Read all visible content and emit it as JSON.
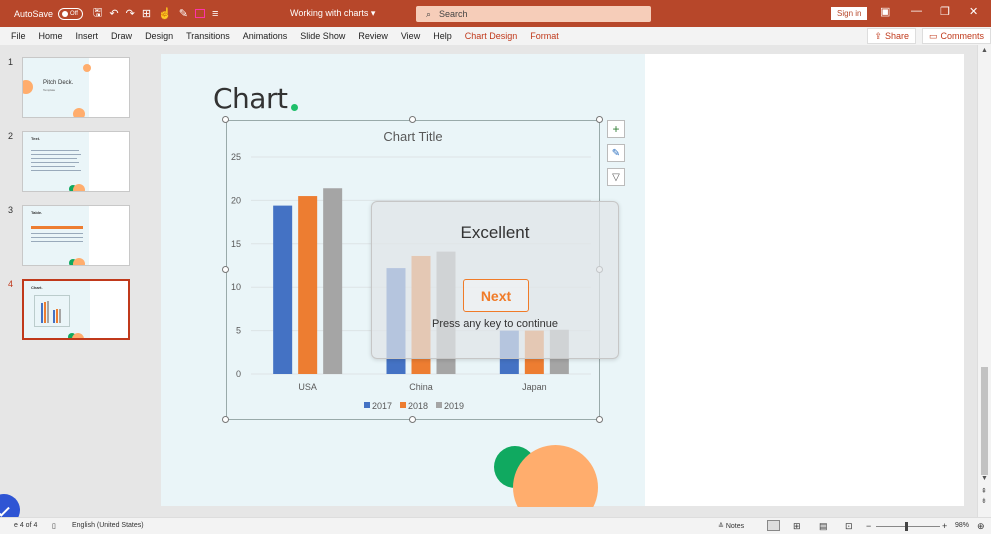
{
  "titlebar": {
    "autosave_label": "AutoSave",
    "autosave_state": "Off",
    "doc_title": "Working with charts",
    "search_placeholder": "Search",
    "sign_in": "Sign in"
  },
  "menu": {
    "tabs": [
      "File",
      "Home",
      "Insert",
      "Draw",
      "Design",
      "Transitions",
      "Animations",
      "Slide Show",
      "Review",
      "View",
      "Help",
      "Chart Design",
      "Format"
    ],
    "share": "Share",
    "comments": "Comments"
  },
  "thumbnails": [
    {
      "number": "1",
      "title": "Pitch Deck.",
      "subtitle": "Template"
    },
    {
      "number": "2",
      "title": "Text."
    },
    {
      "number": "3",
      "title": "Table."
    },
    {
      "number": "4",
      "title": "Chart."
    }
  ],
  "slide": {
    "heading": "Chart"
  },
  "chart_data": {
    "type": "bar",
    "title": "Chart Title",
    "categories": [
      "USA",
      "China",
      "Japan"
    ],
    "series": [
      {
        "name": "2017",
        "color": "#4472c4",
        "values": [
          19.4,
          12.2,
          5
        ]
      },
      {
        "name": "2018",
        "color": "#ed7d31",
        "values": [
          20.5,
          13.6,
          5
        ]
      },
      {
        "name": "2019",
        "color": "#a5a5a5",
        "values": [
          21.4,
          14.1,
          5.1
        ]
      }
    ],
    "ylim": [
      0,
      25
    ],
    "yticks": [
      "0",
      "5",
      "10",
      "15",
      "20",
      "25"
    ],
    "legend_position": "bottom",
    "grid": true
  },
  "overlay": {
    "title": "Excellent",
    "button": "Next",
    "hint": "Press any key to continue"
  },
  "status": {
    "slide_count": "e 4 of 4",
    "language": "English (United States)",
    "notes": "Notes",
    "zoom": "98%"
  }
}
